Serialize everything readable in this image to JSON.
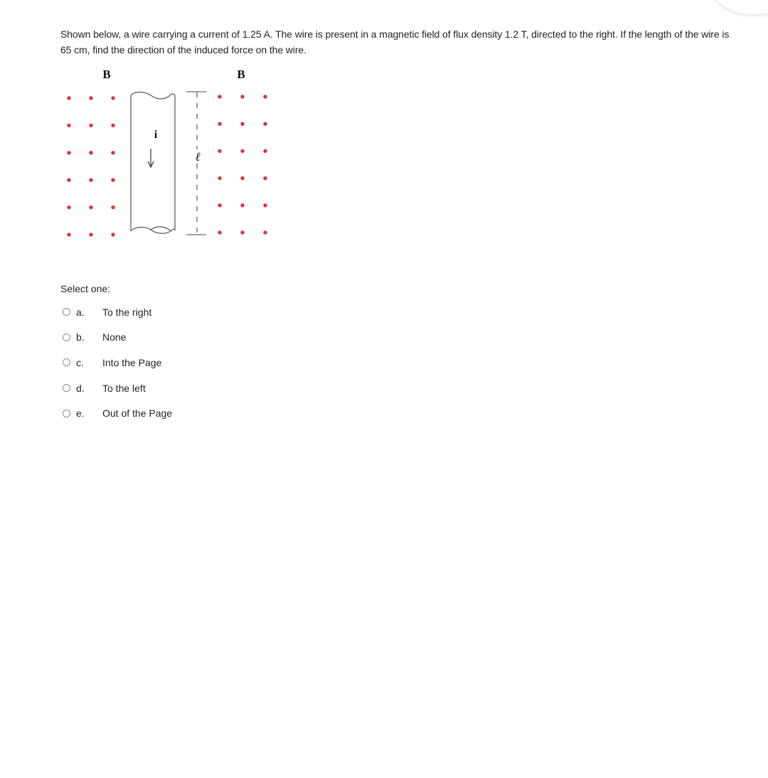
{
  "question": {
    "text": "Shown below, a wire carrying a current of 1.25 A. The wire is present in a magnetic field of flux density 1.2 T, directed to the right. If the length of the wire is 65 cm, find the direction of the induced force on the wire."
  },
  "figure": {
    "left_field_label": "B",
    "right_field_label": "B",
    "current_label": "i",
    "length_label": "ℓ",
    "dot_color": "#e0323c",
    "dot_rows": 6,
    "dot_cols_each_side": 3
  },
  "select_label": "Select one:",
  "options": [
    {
      "letter": "a.",
      "label": "To the right"
    },
    {
      "letter": "b.",
      "label": "None"
    },
    {
      "letter": "c.",
      "label": "Into the Page"
    },
    {
      "letter": "d.",
      "label": "To the left"
    },
    {
      "letter": "e.",
      "label": "Out of the Page"
    }
  ]
}
